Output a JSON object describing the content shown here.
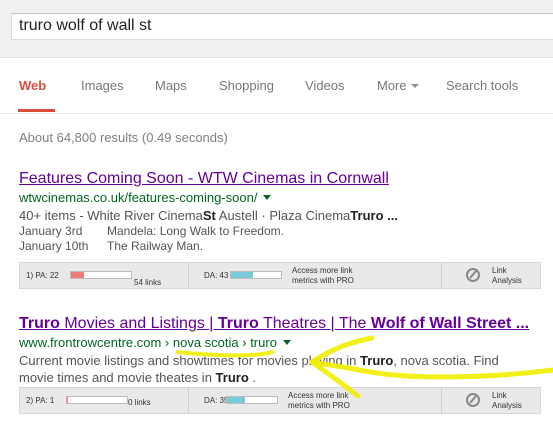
{
  "search": {
    "query": "truro wolf of wall st"
  },
  "tabs": [
    {
      "label": "Web"
    },
    {
      "label": "Images"
    },
    {
      "label": "Maps"
    },
    {
      "label": "Shopping"
    },
    {
      "label": "Videos"
    },
    {
      "label": "More"
    },
    {
      "label": "Search tools"
    }
  ],
  "stats": "About 64,800 results (0.49 seconds)",
  "results": [
    {
      "title": "Features Coming Soon - WTW Cinemas in Cornwall",
      "url": "wtwcinemas.co.uk/features-coming-soon/",
      "snippet_a": "40+ items - White River Cinema",
      "snippet_b": "St",
      "snippet_c": " Austell · Plaza Cinema",
      "snippet_d": "Truro",
      "snippet_e": "  ...",
      "events": [
        {
          "date": "January 3rd",
          "title": "Mandela: Long Walk to Freedom."
        },
        {
          "date": "January 10th",
          "title": "The Railway Man."
        }
      ],
      "moz": {
        "pa_label": "1) PA: 22",
        "pa": 22,
        "links": "54 links",
        "da_label": "DA: 43",
        "da": 43,
        "more": [
          "Access more link",
          "metrics with PRO"
        ],
        "analysis": [
          "Link",
          "Analysis"
        ]
      }
    },
    {
      "title_parts": [
        "Truro",
        " Movies and Listings | ",
        "Truro",
        " Theatres | The ",
        "Wolf of Wall Street",
        " ..."
      ],
      "url": "www.frontrowcentre.com › nova scotia › truro",
      "snippet_1a": "Current movie listings and showtimes for movies playing in ",
      "snippet_1b": "Truro",
      "snippet_1c": ", nova scotia. Find",
      "snippet_2a": "movie times and movie theates in ",
      "snippet_2b": "Truro",
      "snippet_2c": " .",
      "moz": {
        "pa_label": "2) PA: 1",
        "pa": 1,
        "links": "0 links",
        "da_label": "DA: 35",
        "da": 35,
        "more": [
          "Access more link",
          "metrics with PRO"
        ],
        "analysis": [
          "Link",
          "Analysis"
        ]
      }
    }
  ],
  "colors": {
    "accent": "#dd4b39",
    "visited": "#660099",
    "url": "#006621",
    "highlight": "#f2ee00",
    "pa_fill": "#f07a7a",
    "da_fill": "#7ccbd8"
  }
}
